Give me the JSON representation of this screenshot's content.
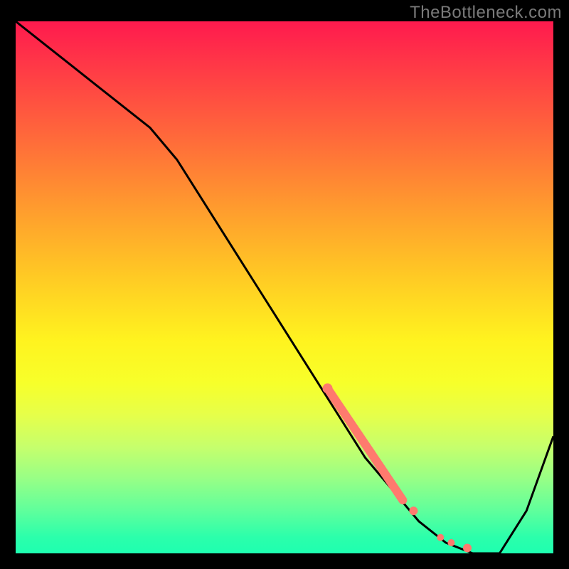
{
  "watermark": "TheBottleneck.com",
  "chart_data": {
    "type": "line",
    "title": "",
    "xlabel": "",
    "ylabel": "",
    "ylim": [
      0,
      100
    ],
    "xlim": [
      0,
      100
    ],
    "series": [
      {
        "name": "curve",
        "color": "#000000",
        "x": [
          0,
          5,
          10,
          15,
          20,
          25,
          30,
          35,
          40,
          45,
          50,
          55,
          60,
          65,
          70,
          75,
          80,
          85,
          90,
          95,
          100
        ],
        "y": [
          100,
          96,
          92,
          88,
          84,
          80,
          74,
          66,
          58,
          50,
          42,
          34,
          26,
          18,
          12,
          6,
          2,
          0,
          0,
          8,
          22
        ]
      }
    ],
    "highlight_segment": {
      "color": "#ff7a6e",
      "x": [
        58,
        60,
        62,
        64,
        66,
        68,
        70,
        72,
        74,
        79,
        81,
        84
      ],
      "y": [
        31,
        28,
        25,
        22,
        19,
        16,
        13,
        10,
        8,
        3,
        2,
        1
      ]
    },
    "gradient_stops": [
      {
        "pos": 0,
        "color": "#ff1a4e"
      },
      {
        "pos": 22,
        "color": "#ff6a3a"
      },
      {
        "pos": 48,
        "color": "#ffca24"
      },
      {
        "pos": 68,
        "color": "#f7ff2a"
      },
      {
        "pos": 86,
        "color": "#97ff86"
      },
      {
        "pos": 100,
        "color": "#1effb0"
      }
    ]
  }
}
